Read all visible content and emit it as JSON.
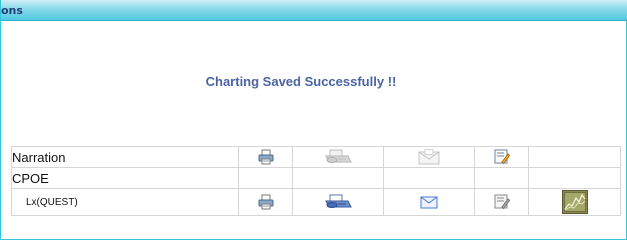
{
  "header": {
    "title": "ons",
    "accent": "#50c8e0"
  },
  "message": {
    "text": "Charting Saved Successfully !!",
    "color": "#4a64a4"
  },
  "table": {
    "rows": [
      {
        "label": "Narration",
        "icons": [
          "print-icon",
          "fax-icon-disabled",
          "email-icon-disabled",
          "edit-note-icon",
          ""
        ]
      },
      {
        "label": "CPOE",
        "icons": [
          "",
          "",
          "",
          "",
          ""
        ]
      },
      {
        "label": "Lx(QUEST)",
        "icons": [
          "print-icon",
          "fax-icon",
          "email-icon",
          "edit-note-icon-gray",
          "chart-icon"
        ]
      }
    ]
  }
}
